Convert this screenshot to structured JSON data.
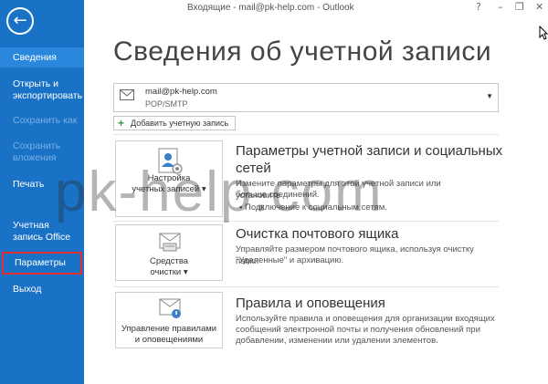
{
  "window": {
    "title": "Входящие - mail@pk-help.com - Outlook",
    "controls": [
      "?",
      "–",
      "❐",
      "✕"
    ]
  },
  "sidebar": {
    "back_icon": "arrow-left-icon",
    "items": [
      {
        "label": "Сведения",
        "state": "selected"
      },
      {
        "label": "Открыть и экспортировать",
        "state": "normal"
      },
      {
        "label": "Сохранить как",
        "state": "disabled"
      },
      {
        "label": "Сохранить вложения",
        "state": "disabled"
      },
      {
        "label": "Печать",
        "state": "normal"
      },
      {
        "label": "Учетная запись Office",
        "state": "normal"
      },
      {
        "label": "Параметры",
        "state": "highlighted"
      },
      {
        "label": "Выход",
        "state": "normal"
      }
    ]
  },
  "main": {
    "title": "Сведения об учетной записи",
    "account": {
      "email": "mail@pk-help.com",
      "type": "POP/SMTP"
    },
    "add_account_label": "Добавить учетную запись",
    "sections": [
      {
        "tile_label_1": "Настройка",
        "tile_label_2": "учетных записей ▾",
        "title_1": "Параметры учетной записи и социальных",
        "title_2": "сетей",
        "desc_1": "Измените параметры для этой учетной записи или установите",
        "desc_2": "больше соединений.",
        "bullet": "▪ Подключение к социальным сетям."
      },
      {
        "tile_label_1": "Средства",
        "tile_label_2": "очистки ▾",
        "title_1": "Очистка почтового ящика",
        "desc_1": "Управляйте размером почтового ящика, используя очистку папки",
        "desc_2": "\"Удаленные\" и архивацию."
      },
      {
        "tile_label_1": "Управление правилами",
        "tile_label_2": "и оповещениями",
        "title_1": "Правила и оповещения",
        "desc_1": "Используйте правила и оповещения для организации входящих",
        "desc_2": "сообщений электронной почты и получения обновлений при",
        "desc_3": "добавлении, изменении или удалении элементов."
      }
    ]
  },
  "watermark": "pk-help.com",
  "colors": {
    "sidebar": "#1a72c6",
    "selected": "#2a87dc",
    "highlight_border": "#e03030"
  }
}
